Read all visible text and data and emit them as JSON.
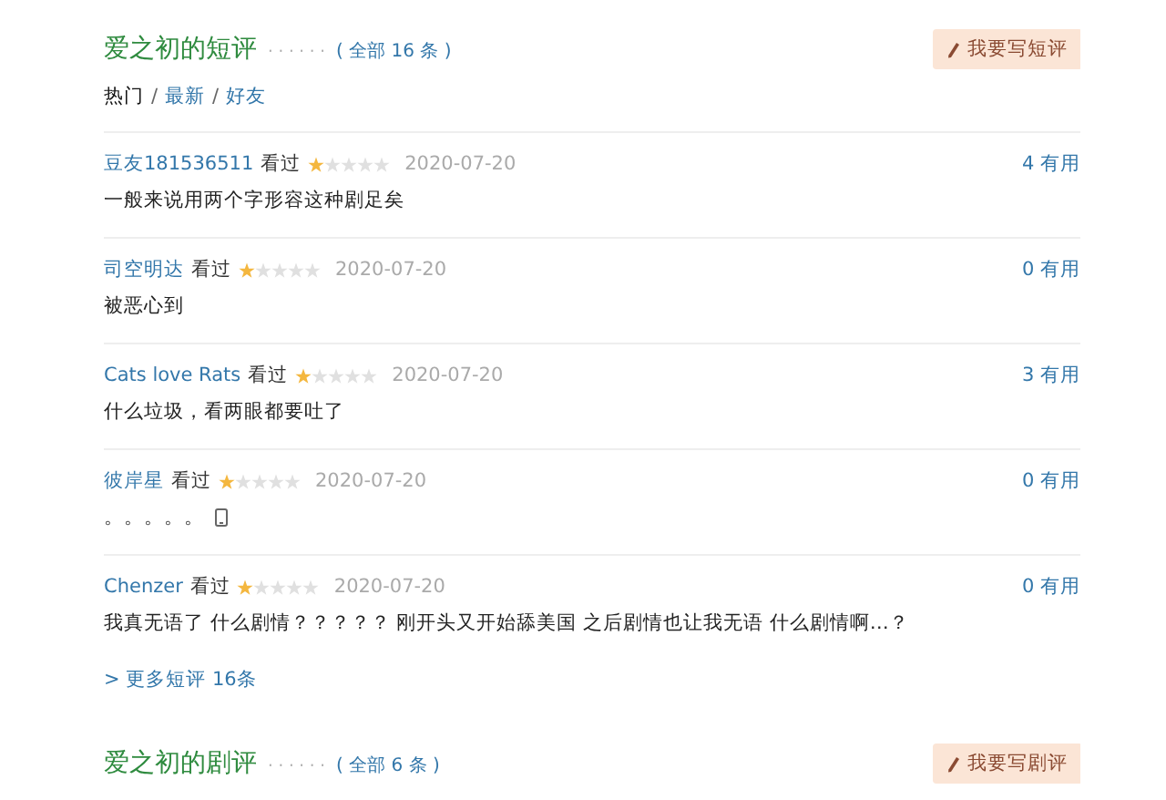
{
  "short_reviews": {
    "title": "爱之初的短评",
    "dots": "· · · · · ·",
    "count": "( 全部 16 条 )",
    "write_button": "我要写短评",
    "tab_separator": "/",
    "tabs": [
      {
        "label": "热门",
        "selected": true
      },
      {
        "label": "最新",
        "selected": false
      },
      {
        "label": "好友",
        "selected": false
      }
    ],
    "reviews": [
      {
        "user": "豆友181536511",
        "action": "看过",
        "stars": 1,
        "date": "2020-07-20",
        "useful": "4 有用",
        "text": "一般来说用两个字形容这种剧足矣",
        "phone": false
      },
      {
        "user": "司空明达",
        "action": "看过",
        "stars": 1,
        "date": "2020-07-20",
        "useful": "0 有用",
        "text": "被恶心到",
        "phone": false
      },
      {
        "user": "Cats love Rats",
        "action": "看过",
        "stars": 1,
        "date": "2020-07-20",
        "useful": "3 有用",
        "text": "什么垃圾，看两眼都要吐了",
        "phone": false
      },
      {
        "user": "彼岸星",
        "action": "看过",
        "stars": 1,
        "date": "2020-07-20",
        "useful": "0 有用",
        "text": "。。。。。",
        "phone": true
      },
      {
        "user": "Chenzer",
        "action": "看过",
        "stars": 1,
        "date": "2020-07-20",
        "useful": "0 有用",
        "text": "我真无语了 什么剧情？？？？？ 刚开头又开始舔美国 之后剧情也让我无语 什么剧情啊…？",
        "phone": false
      }
    ],
    "more_link": "> 更多短评 16条"
  },
  "drama_reviews": {
    "title": "爱之初的剧评",
    "dots": "· · · · · ·",
    "count": "( 全部 6 条 )",
    "write_button": "我要写剧评"
  }
}
